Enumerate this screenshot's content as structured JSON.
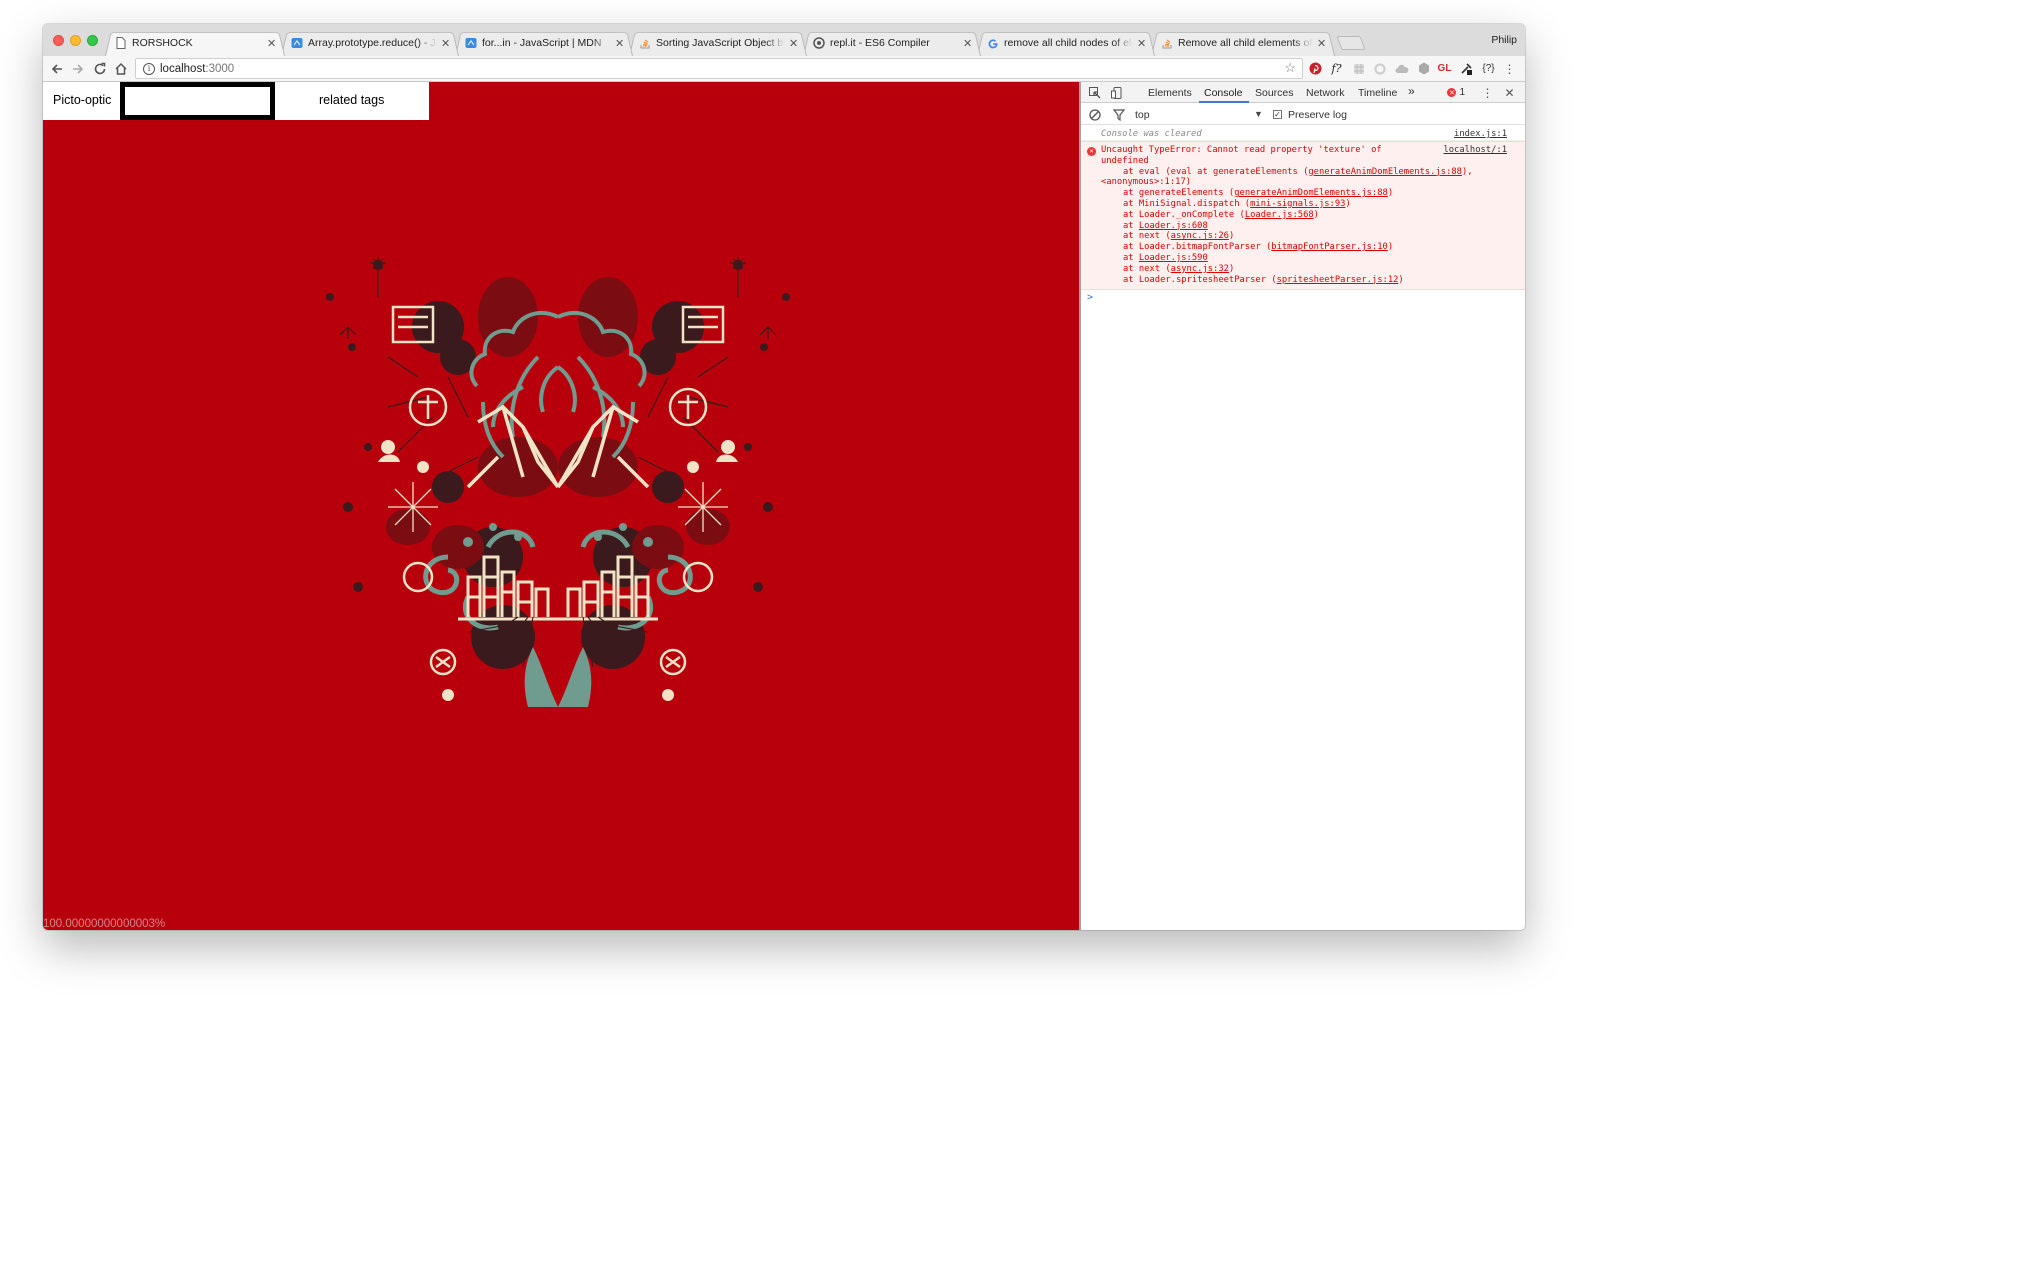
{
  "browser": {
    "tabs": [
      {
        "title": "RORSHOCK",
        "icon": "document-icon",
        "active": true
      },
      {
        "title": "Array.prototype.reduce() - JavaScript | MDN",
        "icon": "mdn-icon"
      },
      {
        "title": "for...in - JavaScript | MDN",
        "icon": "mdn-icon"
      },
      {
        "title": "Sorting JavaScript Object by property value",
        "icon": "stackoverflow-icon"
      },
      {
        "title": "repl.it - ES6 Compiler",
        "icon": "replit-icon"
      },
      {
        "title": "remove all child nodes of element",
        "icon": "google-icon"
      },
      {
        "title": "Remove all child elements of a DOM node",
        "icon": "stackoverflow-icon"
      }
    ],
    "profile_name": "Philip",
    "url_host": "localhost",
    "url_port": ":3000"
  },
  "page": {
    "brand": "Picto-optic",
    "search_value": "",
    "related_tags_label": "related tags",
    "progress_text": "100.00000000000003%",
    "background_color": "#b8000c",
    "art_colors": {
      "cream": "#f1e3c6",
      "teal": "#6f9c8f",
      "dark": "#3a1a1c",
      "maroon": "#7b0d12"
    }
  },
  "devtools": {
    "tabs": [
      "Elements",
      "Console",
      "Sources",
      "Network",
      "Timeline"
    ],
    "active_tab": "Console",
    "more_tabs": "»",
    "error_count": "1",
    "context": "top",
    "preserve_log_label": "Preserve log",
    "preserve_log_checked": true,
    "cleared_message": "Console was cleared",
    "cleared_source": "index.js:1",
    "error": {
      "lines": [
        "Uncaught TypeError: Cannot read property 'texture' of",
        "undefined"
      ],
      "source": "localhost/:1",
      "frames": [
        {
          "text": "    at eval (eval at generateElements (",
          "loc": "generateAnimDomElements.js:88",
          "tail": "),"
        },
        {
          "text": "<anonymous>:1:17)",
          "loc": "",
          "tail": "",
          "flush": true
        },
        {
          "text": "    at generateElements (",
          "loc": "generateAnimDomElements.js:88",
          "tail": ")"
        },
        {
          "text": "    at MiniSignal.dispatch (",
          "loc": "mini-signals.js:93",
          "tail": ")"
        },
        {
          "text": "    at Loader._onComplete (",
          "loc": "Loader.js:568",
          "tail": ")"
        },
        {
          "text": "    at ",
          "loc": "Loader.js:608",
          "tail": ""
        },
        {
          "text": "    at next (",
          "loc": "async.js:26",
          "tail": ")"
        },
        {
          "text": "    at Loader.bitmapFontParser (",
          "loc": "bitmapFontParser.js:10",
          "tail": ")"
        },
        {
          "text": "    at ",
          "loc": "Loader.js:590",
          "tail": ""
        },
        {
          "text": "    at next (",
          "loc": "async.js:32",
          "tail": ")"
        },
        {
          "text": "    at Loader.spritesheetParser (",
          "loc": "spritesheetParser.js:12",
          "tail": ")"
        }
      ]
    },
    "prompt_symbol": ">"
  }
}
